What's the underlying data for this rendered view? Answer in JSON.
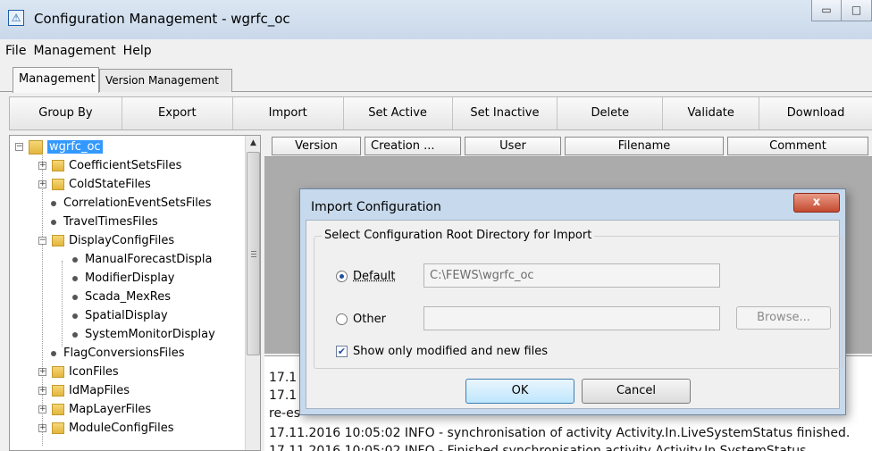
{
  "window": {
    "title": "Configuration Management - wgrfc_oc",
    "icon": "app-logo-icon",
    "minimize_glyph": "▭",
    "maximize_glyph": "□"
  },
  "menu": [
    "File",
    "Management",
    "Help"
  ],
  "tabs": [
    {
      "label": "Management",
      "active": true
    },
    {
      "label": "Version Management",
      "active": false
    }
  ],
  "toolbar": [
    "Group By",
    "Export",
    "Import",
    "Set Active",
    "Set Inactive",
    "Delete",
    "Validate",
    "Download"
  ],
  "tree": {
    "root": "wgrfc_oc",
    "items": [
      {
        "label": "CoefficientSetsFiles",
        "level": 1,
        "type": "folder",
        "expandable": true
      },
      {
        "label": "ColdStateFiles",
        "level": 1,
        "type": "folder",
        "expandable": true
      },
      {
        "label": "CorrelationEventSetsFiles",
        "level": 1,
        "type": "leaf"
      },
      {
        "label": "TravelTimesFiles",
        "level": 1,
        "type": "leaf"
      },
      {
        "label": "DisplayConfigFiles",
        "level": 1,
        "type": "folder",
        "expanded": true
      },
      {
        "label": "ManualForecastDispla",
        "level": 2,
        "type": "leaf"
      },
      {
        "label": "ModifierDisplay",
        "level": 2,
        "type": "leaf"
      },
      {
        "label": "Scada_MexRes",
        "level": 2,
        "type": "leaf"
      },
      {
        "label": "SpatialDisplay",
        "level": 2,
        "type": "leaf"
      },
      {
        "label": "SystemMonitorDisplay",
        "level": 2,
        "type": "leaf"
      },
      {
        "label": "FlagConversionsFiles",
        "level": 1,
        "type": "leaf"
      },
      {
        "label": "IconFiles",
        "level": 1,
        "type": "folder",
        "expandable": true
      },
      {
        "label": "IdMapFiles",
        "level": 1,
        "type": "folder",
        "expandable": true
      },
      {
        "label": "MapLayerFiles",
        "level": 1,
        "type": "folder",
        "expandable": true
      },
      {
        "label": "ModuleConfigFiles",
        "level": 1,
        "type": "folder",
        "expandable": true
      }
    ]
  },
  "table": {
    "columns": [
      "Version",
      "Creation ...",
      "User",
      "Filename",
      "Comment"
    ]
  },
  "log": {
    "lines": [
      "17.1",
      "17.1",
      "re-es",
      "17.11.2016 10:05:02 INFO - synchronisation of activity Activity.In.LiveSystemStatus finished.",
      "17.11.2016 10:05:02 INFO - Finished synchronisation activity Activity.In.SystemStatus"
    ]
  },
  "dialog": {
    "title": "Import Configuration",
    "close_glyph": "x",
    "group_title": "Select Configuration Root Directory for Import",
    "default_label": "Default",
    "default_path": "C:\\FEWS\\wgrfc_oc",
    "other_label": "Other",
    "other_path": "",
    "browse_label": "Browse...",
    "show_modified_label": "Show only modified and new files",
    "show_modified_checked": true,
    "ok_label": "OK",
    "cancel_label": "Cancel"
  }
}
